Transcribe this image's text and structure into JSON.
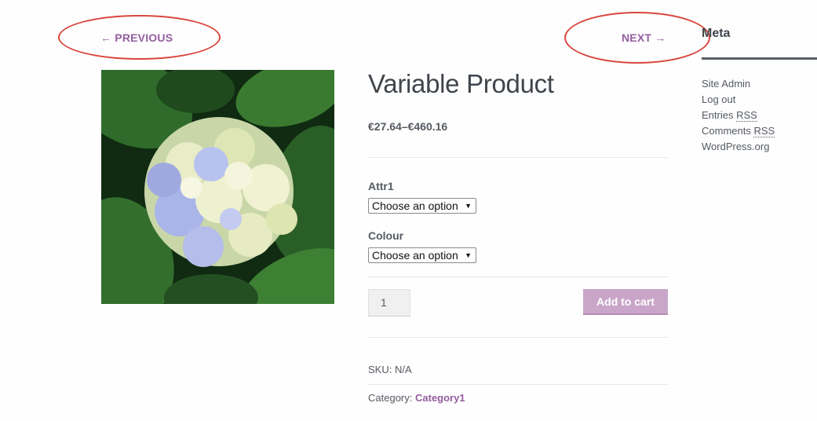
{
  "navigation": {
    "previous_label": "← PREVIOUS",
    "next_label": "NEXT →"
  },
  "product": {
    "title": "Variable Product",
    "price": "€27.64–€460.16",
    "image_subject": "hydrangea flower",
    "attributes": [
      {
        "label": "Attr1",
        "selected": "Choose an option"
      },
      {
        "label": "Colour",
        "selected": "Choose an option"
      }
    ],
    "quantity": "1",
    "add_to_cart_label": "Add to cart",
    "sku_label": "SKU:",
    "sku_value": "N/A",
    "category_label": "Category:",
    "category_value": "Category1"
  },
  "sidebar": {
    "widget_title": "Meta",
    "links": [
      {
        "text": "Site Admin"
      },
      {
        "text": "Log out"
      },
      {
        "text": "Entries ",
        "abbr": "RSS"
      },
      {
        "text": "Comments ",
        "abbr": "RSS"
      },
      {
        "text": "WordPress.org"
      }
    ]
  },
  "colors": {
    "accent": "#955ea0",
    "button": "#c9a6c9",
    "annotation": "#d9463e"
  }
}
